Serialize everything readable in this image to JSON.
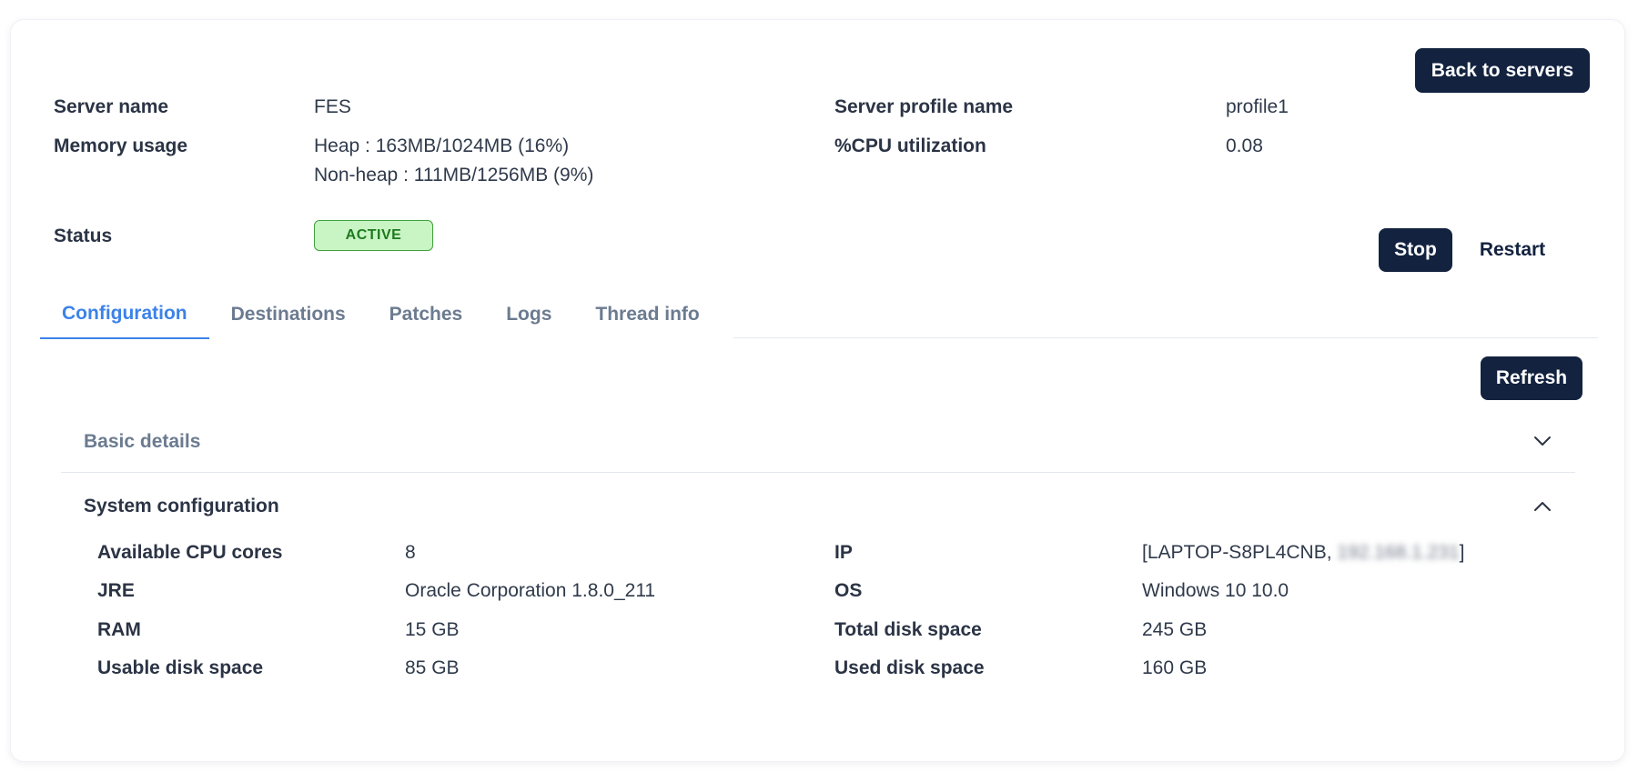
{
  "header": {
    "back_button": "Back to servers"
  },
  "server": {
    "name_label": "Server name",
    "name_value": "FES",
    "profile_label": "Server profile name",
    "profile_value": "profile1",
    "memory_label": "Memory usage",
    "memory_heap": "Heap : 163MB/1024MB (16%)",
    "memory_nonheap": "Non-heap : 111MB/1256MB (9%)",
    "cpu_label": "%CPU utilization",
    "cpu_value": "0.08",
    "status_label": "Status",
    "status_value": "ACTIVE"
  },
  "actions": {
    "stop": "Stop",
    "restart": "Restart",
    "refresh": "Refresh"
  },
  "tabs": [
    {
      "label": "Configuration",
      "active": true
    },
    {
      "label": "Destinations",
      "active": false
    },
    {
      "label": "Patches",
      "active": false
    },
    {
      "label": "Logs",
      "active": false
    },
    {
      "label": "Thread info",
      "active": false
    }
  ],
  "sections": {
    "basic_details": "Basic details",
    "system_configuration": "System configuration"
  },
  "system_config": {
    "cpu_cores_label": "Available CPU cores",
    "cpu_cores_value": "8",
    "jre_label": "JRE",
    "jre_value": "Oracle Corporation 1.8.0_211",
    "ram_label": "RAM",
    "ram_value": "15 GB",
    "usable_disk_label": "Usable disk space",
    "usable_disk_value": "85 GB",
    "ip_label": "IP",
    "ip_value_prefix": "[LAPTOP-S8PL4CNB, ",
    "ip_value_blurred": "192.168.1.231",
    "ip_value_suffix": "]",
    "os_label": "OS",
    "os_value": "Windows 10 10.0",
    "total_disk_label": "Total disk space",
    "total_disk_value": "245 GB",
    "used_disk_label": "Used disk space",
    "used_disk_value": "160 GB"
  },
  "colors": {
    "primary_button": "#13223f",
    "active_tab": "#3c82e8",
    "status_bg": "#c9f5c4",
    "status_border": "#3fa23a"
  }
}
